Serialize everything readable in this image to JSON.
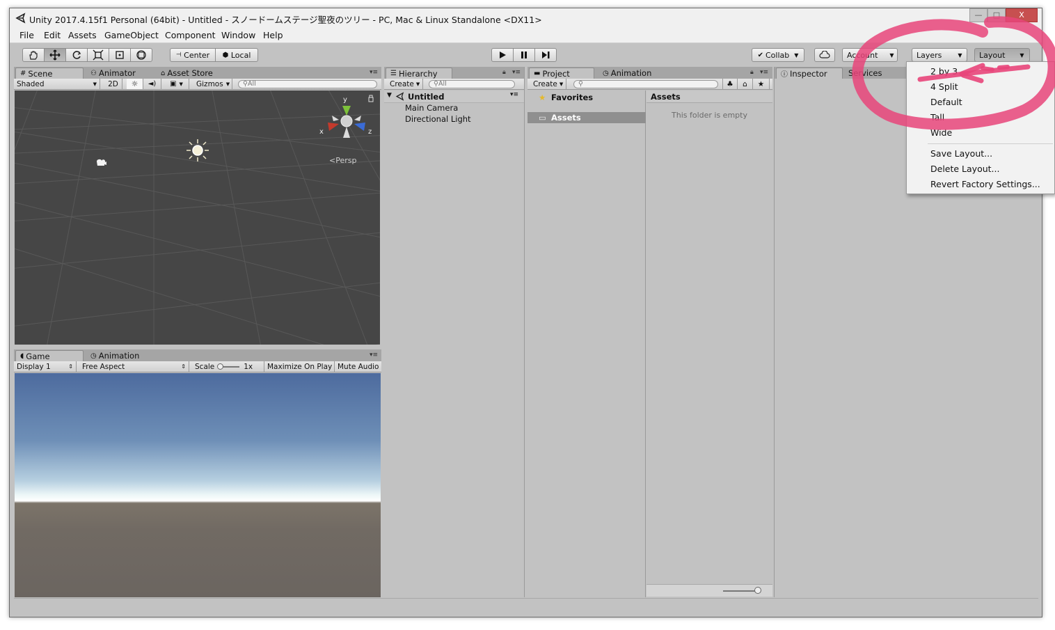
{
  "window": {
    "title": "Unity 2017.4.15f1 Personal (64bit) - Untitled - スノードームステージ聖夜のツリー - PC, Mac & Linux Standalone <DX11>",
    "controls": [
      "—",
      "□",
      "X"
    ]
  },
  "menubar": [
    "File",
    "Edit",
    "Assets",
    "GameObject",
    "Component",
    "Window",
    "Help"
  ],
  "toolbar": {
    "transform_tools": [
      "hand-tool",
      "move-tool",
      "rotate-tool",
      "scale-tool",
      "rect-tool",
      "transform-tool"
    ],
    "active_tool": "move-tool",
    "pivot_label": "Center",
    "space_label": "Local",
    "play_controls": [
      "play",
      "pause",
      "step"
    ],
    "collab_label": "Collab",
    "account_label": "Account",
    "layers_label": "Layers",
    "layout_label": "Layout"
  },
  "scene_panel": {
    "tabs": [
      "Scene",
      "Animator",
      "Asset Store"
    ],
    "shading": "Shaded",
    "mode_2d": "2D",
    "gizmos_label": "Gizmos",
    "search_placeholder": "All",
    "axes": {
      "y": "y",
      "x": "x",
      "z": "z"
    },
    "projection": "Persp"
  },
  "game_panel": {
    "tabs": [
      "Game",
      "Animation"
    ],
    "display": "Display 1",
    "aspect": "Free Aspect",
    "scale_label": "Scale",
    "scale_value": "1x",
    "maximize_label": "Maximize On Play",
    "mute_label": "Mute Audio"
  },
  "hierarchy_panel": {
    "tab": "Hierarchy",
    "create_label": "Create",
    "search_placeholder": "All",
    "scene_name": "Untitled",
    "items": [
      "Main Camera",
      "Directional Light"
    ]
  },
  "project_panel": {
    "tabs": [
      "Project",
      "Animation"
    ],
    "create_label": "Create",
    "favorites_label": "Favorites",
    "assets_folder": "Assets",
    "content_header": "Assets",
    "empty_message": "This folder is empty"
  },
  "inspector_panel": {
    "tabs": [
      "Inspector",
      "Services"
    ]
  },
  "layout_dropdown": {
    "items": [
      "2 by 3",
      "4 Split",
      "Default",
      "Tall",
      "Wide"
    ],
    "actions": [
      "Save Layout...",
      "Delete Layout...",
      "Revert Factory Settings..."
    ]
  },
  "colors": {
    "editor_bg": "#c2c2c2",
    "scene_bg": "#464646",
    "annotation": "#e8457a",
    "menu_bg": "#f2f2f2"
  }
}
